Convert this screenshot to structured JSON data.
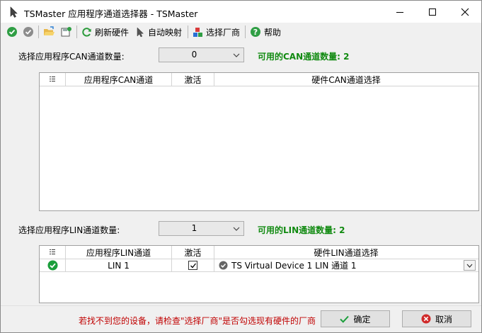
{
  "window": {
    "title": "TSMaster 应用程序通道选择器 - TSMaster"
  },
  "toolbar": {
    "refresh_label": "刷新硬件",
    "automap_label": "自动映射",
    "vendor_label": "选择厂商",
    "help_label": "帮助"
  },
  "can": {
    "count_label": "选择应用程序CAN通道数量:",
    "count_value": "0",
    "available": "可用的CAN通道数量: 2",
    "columns": [
      "应用程序CAN通道",
      "激活",
      "硬件CAN通道选择"
    ]
  },
  "lin": {
    "count_label": "选择应用程序LIN通道数量:",
    "count_value": "1",
    "available": "可用的LIN通道数量: 2",
    "columns": [
      "应用程序LIN通道",
      "激活",
      "硬件LIN通道选择"
    ],
    "rows": [
      {
        "channel": "LIN 1",
        "active": true,
        "hardware": "TS Virtual Device 1 LIN 通道 1"
      }
    ]
  },
  "footer": {
    "hint": "若找不到您的设备，请检查\"选择厂商\"是否勾选现有硬件的厂商",
    "ok_label": "确定",
    "cancel_label": "取消"
  },
  "colors": {
    "available_green": "#118a11",
    "hint_red": "#c00000",
    "status_green": "#1a9e3a"
  }
}
